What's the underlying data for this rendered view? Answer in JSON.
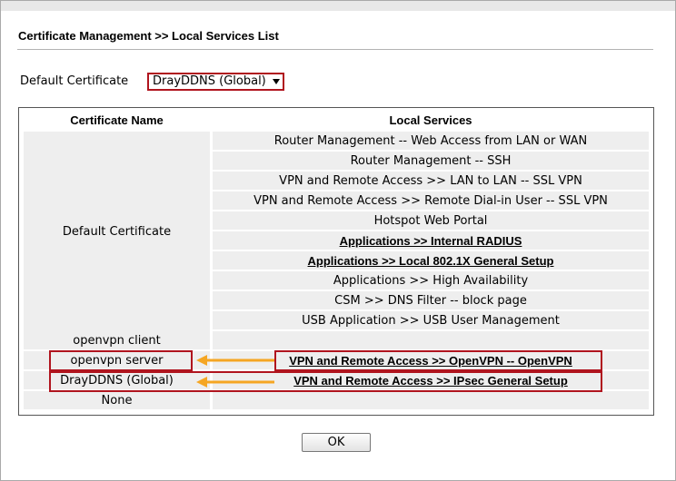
{
  "page": {
    "title": "Certificate Management >> Local Services List",
    "default_certificate_label": "Default Certificate",
    "default_certificate_value": "DrayDDNS (Global)"
  },
  "table": {
    "headers": {
      "name": "Certificate Name",
      "services": "Local Services"
    },
    "default_group_name": "Default Certificate",
    "default_group_services": [
      "Router Management -- Web Access from LAN or WAN",
      "Router Management -- SSH",
      "VPN and Remote Access >> LAN to LAN -- SSL VPN",
      "VPN and Remote Access >> Remote Dial-in User -- SSL VPN",
      "Hotspot Web Portal",
      "Applications >> Internal RADIUS",
      "Applications >> Local 802.1X General Setup",
      "Applications >> High Availability",
      "CSM >> DNS Filter -- block page",
      "USB Application >> USB User Management"
    ],
    "other_rows": [
      {
        "name": "openvpn client",
        "service": ""
      },
      {
        "name": "openvpn server",
        "service": "VPN and Remote Access >> OpenVPN -- OpenVPN"
      },
      {
        "name": "DrayDDNS (Global)",
        "service": "VPN and Remote Access >> IPsec General Setup"
      },
      {
        "name": "None",
        "service": ""
      }
    ]
  },
  "buttons": {
    "ok": "OK"
  },
  "colors": {
    "highlight": "#b0141e",
    "arrow": "#f5a623",
    "cell_bg": "#eeeeee"
  }
}
